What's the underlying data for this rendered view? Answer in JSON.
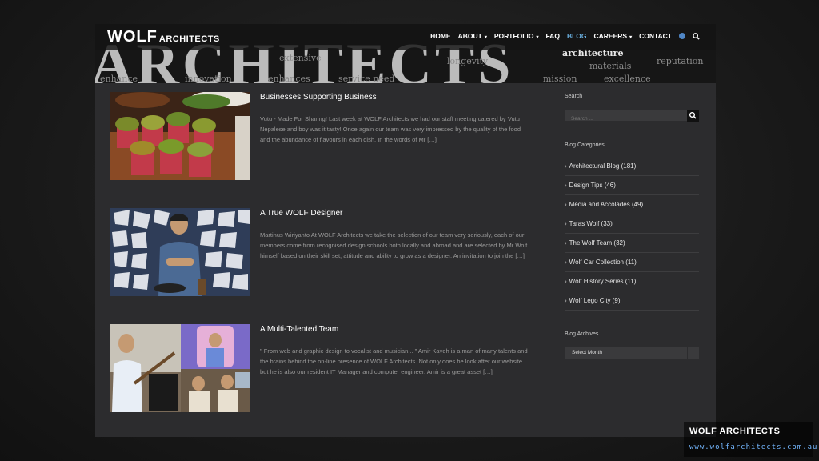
{
  "header": {
    "logo_main": "WOLF",
    "logo_sub": "ARCHITECTS",
    "banner_word": "ARCHITECTS",
    "banner_small_words": [
      "enhance",
      "innovation",
      "enhances",
      "service need",
      "mission",
      "excellence",
      "extensive",
      "architecture",
      "reputation",
      "longevity",
      "materials"
    ],
    "nav": [
      {
        "label": "HOME",
        "dropdown": false,
        "active": false
      },
      {
        "label": "ABOUT",
        "dropdown": true,
        "active": false
      },
      {
        "label": "PORTFOLIO",
        "dropdown": true,
        "active": false
      },
      {
        "label": "FAQ",
        "dropdown": false,
        "active": false
      },
      {
        "label": "BLOG",
        "dropdown": false,
        "active": true
      },
      {
        "label": "CAREERS",
        "dropdown": true,
        "active": false
      },
      {
        "label": "CONTACT",
        "dropdown": false,
        "active": false
      }
    ],
    "icons": [
      "globe-icon",
      "search-icon"
    ]
  },
  "posts": [
    {
      "title": "Businesses Supporting Business",
      "excerpt": "Vutu - Made For Sharing! Last week at WOLF Architects we had our staff meeting catered by Vutu Nepalese and boy was it tasty! Once again our team was very impressed by the quality of the food and the abundance of flavours in each dish. In the words of Mr […]"
    },
    {
      "title": "A True WOLF Designer",
      "excerpt": "Martinus Wiriyanto At WOLF Architects we take the selection of our team very seriously, each of our members come from recognised design schools both locally and abroad and are selected by Mr Wolf himself based on their skill set, attitude and ability to grow as a designer. An invitation to join the […]"
    },
    {
      "title": "A Multi-Talented Team",
      "excerpt": "\" From web and graphic design to vocalist and musician... \" Amir Kaveh is a man of many talents and the brains behind the on-line presence of WOLF Architects. Not only does he look after our website but he is also our resident IT Manager and computer engineer. Amir is a great asset […]"
    }
  ],
  "sidebar": {
    "search_heading": "Search",
    "search_placeholder": "Search ...",
    "categories_heading": "Blog Categories",
    "categories": [
      "Architectural Blog (181)",
      "Design Tips (46)",
      "Media and Accolades (49)",
      "Taras Wolf (33)",
      "The Wolf Team (32)",
      "Wolf Car Collection (11)",
      "Wolf History Series (11)",
      "Wolf Lego City (9)"
    ],
    "archives_heading": "Blog Archives",
    "archives_selected": "Select Month"
  },
  "watermark": {
    "title": "WOLF ARCHITECTS",
    "url": "www.wolfarchitects.com.au"
  },
  "colors": {
    "page_bg": "#1a1a1a",
    "content_bg": "#2c2c2e",
    "nav_active": "#6ab0e0",
    "watermark_url": "#74b7ff"
  }
}
